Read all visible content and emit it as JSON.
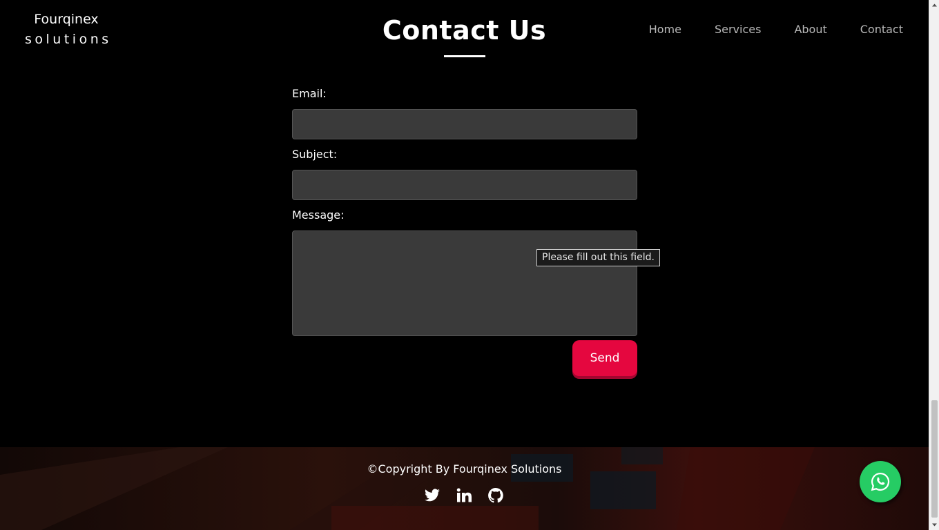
{
  "brand": {
    "line1": "Fourqinex",
    "line2": "solutions"
  },
  "page": {
    "title": "Contact Us"
  },
  "nav": [
    {
      "label": "Home"
    },
    {
      "label": "Services"
    },
    {
      "label": "About"
    },
    {
      "label": "Contact"
    }
  ],
  "form": {
    "email_label": "Email:",
    "email_value": "",
    "subject_label": "Subject:",
    "subject_value": "",
    "message_label": "Message:",
    "message_value": "",
    "send_label": "Send",
    "validation_tooltip": "Please fill out this field."
  },
  "footer": {
    "copyright": "©Copyright By Fourqinex Solutions",
    "social_icons": [
      "twitter-icon",
      "linkedin-icon",
      "github-icon"
    ]
  },
  "whatsapp": {
    "icon": "whatsapp-icon"
  },
  "colors": {
    "accent": "#e5073f",
    "whatsapp": "#26cc64",
    "field_bg": "#3a3a3a",
    "nav_text": "#b9b9b9"
  }
}
